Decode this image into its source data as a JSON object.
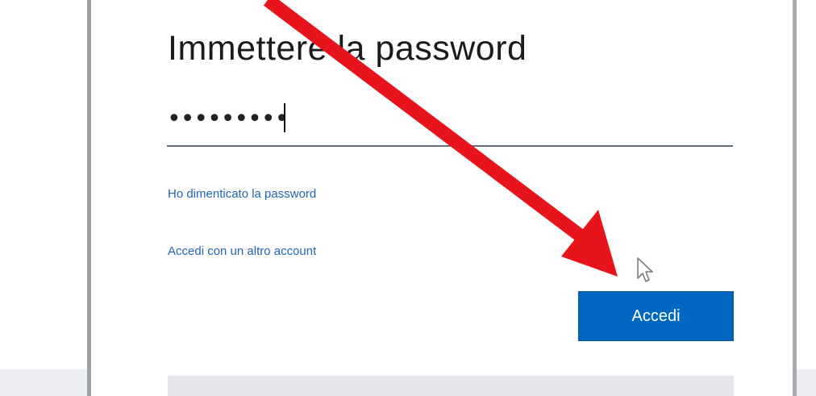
{
  "dialog": {
    "title": "Immettere la password",
    "password": {
      "masked_value": "•••••••••",
      "type": "password"
    },
    "links": {
      "forgot_password": "Ho dimenticato la password",
      "other_account": "Accedi con un altro account"
    },
    "signin_button": "Accedi"
  },
  "annotation": {
    "arrow_color": "#e8141b",
    "icon": "red-arrow-icon"
  },
  "cursor": {
    "icon": "mouse-pointer-icon"
  },
  "colors": {
    "accent": "#0067c0",
    "link": "#1f66b5",
    "text": "#1b1b1b"
  }
}
